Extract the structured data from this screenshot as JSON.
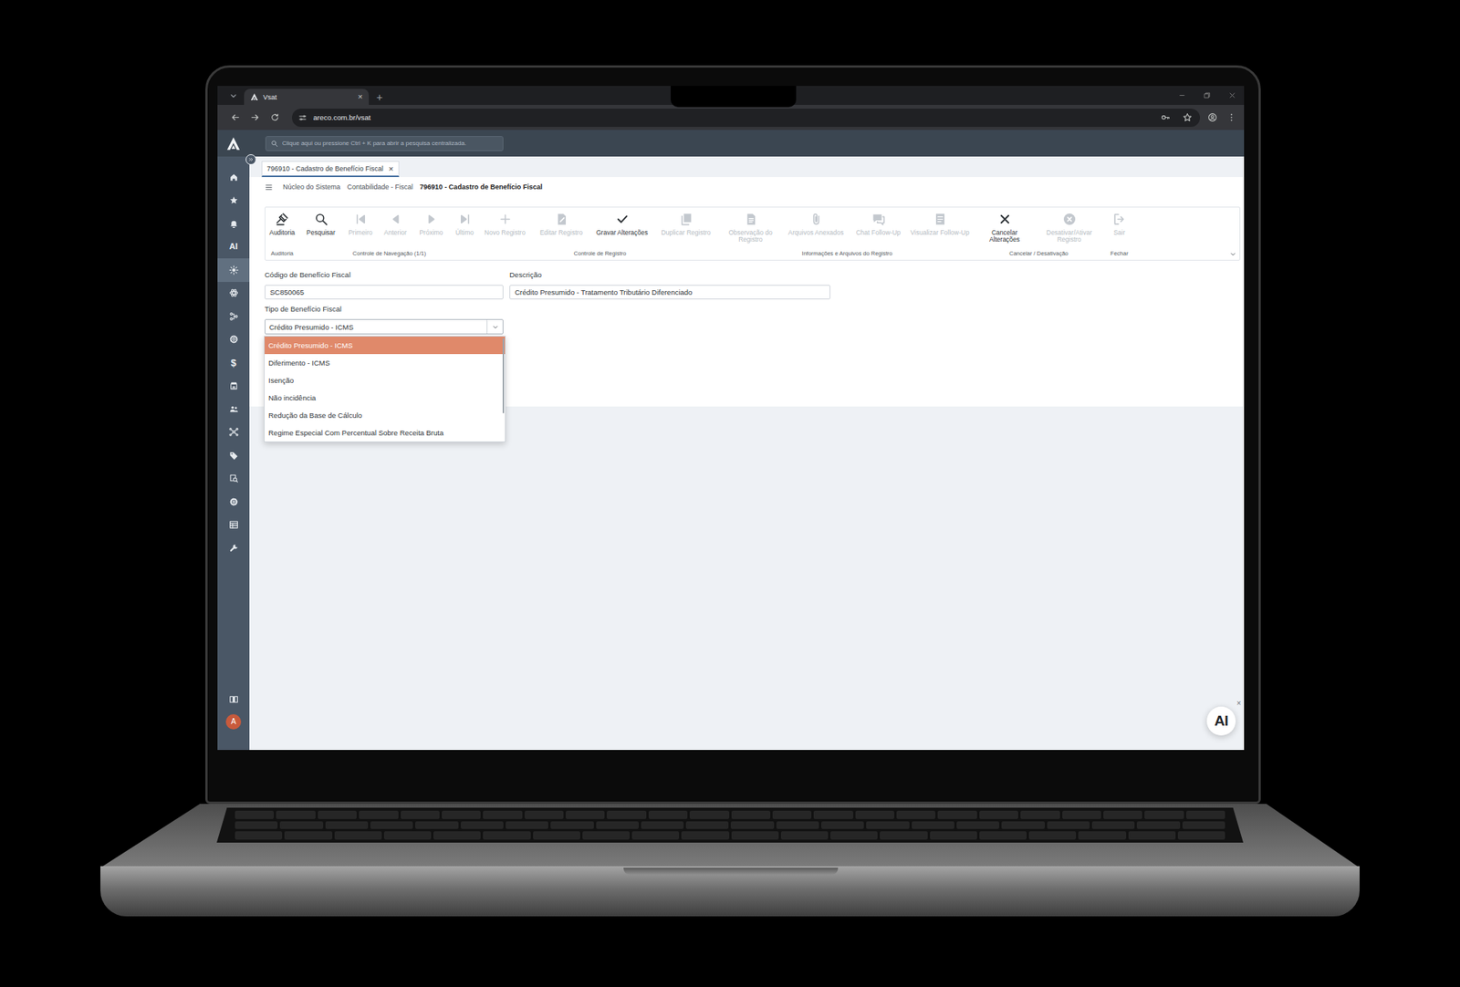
{
  "browser": {
    "tab": {
      "title": "Vsat",
      "close": "×",
      "selected": true
    },
    "new_tab": "+",
    "url": "areco.com.br/vsat"
  },
  "app_header": {
    "search": {
      "placeholder": "Clique aqui ou pressione Ctrl + K para abrir a pesquisa centralizada."
    }
  },
  "sidebar": {
    "items": [
      {
        "kind": "icon",
        "selected": false
      },
      {
        "kind": "icon",
        "selected": false
      },
      {
        "kind": "icon",
        "selected": false
      },
      {
        "kind": "text",
        "label": "AI",
        "selected": false
      },
      {
        "kind": "icon",
        "selected": true
      },
      {
        "kind": "icon",
        "selected": false
      },
      {
        "kind": "icon",
        "selected": false
      },
      {
        "kind": "icon",
        "selected": false
      },
      {
        "kind": "text",
        "label": "$",
        "selected": false
      },
      {
        "kind": "icon",
        "selected": false
      },
      {
        "kind": "icon",
        "selected": false
      },
      {
        "kind": "icon",
        "selected": false
      },
      {
        "kind": "icon",
        "selected": false
      },
      {
        "kind": "icon",
        "selected": false
      },
      {
        "kind": "icon",
        "selected": false
      },
      {
        "kind": "icon",
        "selected": false
      },
      {
        "kind": "icon",
        "selected": false
      }
    ],
    "avatar": "A"
  },
  "tabs": [
    {
      "label": "796910 - Cadastro de Benefício Fiscal",
      "close": "×",
      "selected": true
    }
  ],
  "breadcrumb": [
    "Núcleo do Sistema",
    "Contabilidade - Fiscal",
    "796910 - Cadastro de Benefício Fiscal"
  ],
  "toolbar": {
    "groups": [
      {
        "label": "Auditoria",
        "buttons": [
          {
            "label": "Auditoria",
            "disabled": false
          }
        ]
      },
      {
        "label": "Controle de Navegação (1/1)",
        "buttons": [
          {
            "label": "Pesquisar",
            "disabled": false
          },
          {
            "label": "Primeiro",
            "disabled": true
          },
          {
            "label": "Anterior",
            "disabled": true
          },
          {
            "label": "Próximo",
            "disabled": true
          },
          {
            "label": "Último",
            "disabled": true
          }
        ]
      },
      {
        "label": "Controle de Registro",
        "buttons": [
          {
            "label": "Novo Registro",
            "disabled": true
          },
          {
            "label": "Editar Registro",
            "disabled": true
          },
          {
            "label": "Gravar Alterações",
            "disabled": false
          },
          {
            "label": "Duplicar Registro",
            "disabled": true
          }
        ]
      },
      {
        "label": "Informações e Arquivos do Registro",
        "buttons": [
          {
            "label": "Observação do Registro",
            "disabled": true
          },
          {
            "label": "Arquivos Anexados",
            "disabled": true
          },
          {
            "label": "Chat Follow-Up",
            "disabled": true
          },
          {
            "label": "Visualizar Follow-Up",
            "disabled": true
          }
        ]
      },
      {
        "label": "Cancelar / Desativação",
        "buttons": [
          {
            "label": "Cancelar Alterações",
            "disabled": false
          },
          {
            "label": "Desativar/Ativar Registro",
            "disabled": true
          }
        ]
      },
      {
        "label": "Fechar",
        "buttons": [
          {
            "label": "Sair",
            "disabled": true
          }
        ]
      }
    ]
  },
  "form": {
    "fields": [
      {
        "kind": "text",
        "label": "Código de Benefício Fiscal",
        "value": "SC850065"
      },
      {
        "kind": "text",
        "label": "Descrição",
        "value": "Crédito Presumido - Tratamento Tributário Diferenciado"
      },
      {
        "kind": "select",
        "label": "Tipo de Benefício Fiscal",
        "value": "Crédito Presumido - ICMS",
        "expanded": true,
        "options": [
          {
            "label": "Crédito Presumido - ICMS",
            "selected": true
          },
          {
            "label": "Diferimento - ICMS",
            "selected": false
          },
          {
            "label": "Isenção",
            "selected": false
          },
          {
            "label": "Não incidência",
            "selected": false
          },
          {
            "label": "Redução da Base de Cálculo",
            "selected": false
          },
          {
            "label": "Regime Especial Com Percentual Sobre Receita Bruta",
            "selected": false
          }
        ]
      }
    ]
  },
  "assistant": {
    "label": "AI",
    "close": "×"
  }
}
